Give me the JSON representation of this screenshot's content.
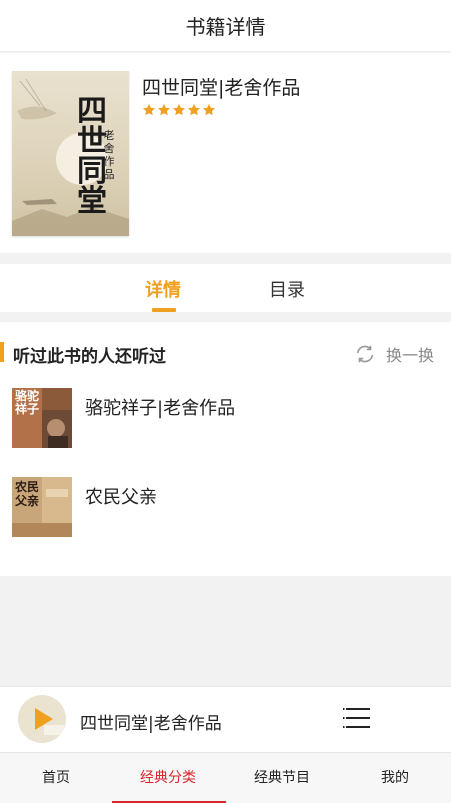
{
  "header": {
    "title": "书籍详情"
  },
  "book": {
    "title": "四世同堂|老舍作品",
    "rating": 5,
    "rating_max": 5,
    "cover_text": {
      "big": "四世同堂",
      "small": "老舍作品"
    }
  },
  "tabs": [
    {
      "label": "详情",
      "active": true
    },
    {
      "label": "目录",
      "active": false
    }
  ],
  "recommend": {
    "title": "听过此书的人还听过",
    "refresh_label": "换一换",
    "items": [
      {
        "name": "骆驼祥子|老舍作品",
        "thumb_text": "骆驼祥子"
      },
      {
        "name": "农民父亲",
        "thumb_text": "农民父亲"
      }
    ]
  },
  "player": {
    "title": "四世同堂|老舍作品"
  },
  "nav": [
    {
      "label": "首页",
      "active": false
    },
    {
      "label": "经典分类",
      "active": true
    },
    {
      "label": "经典节目",
      "active": false
    },
    {
      "label": "我的",
      "active": false
    }
  ],
  "colors": {
    "accent": "#f0a020",
    "nav_active": "#d8262c",
    "star": "#f0a020"
  }
}
